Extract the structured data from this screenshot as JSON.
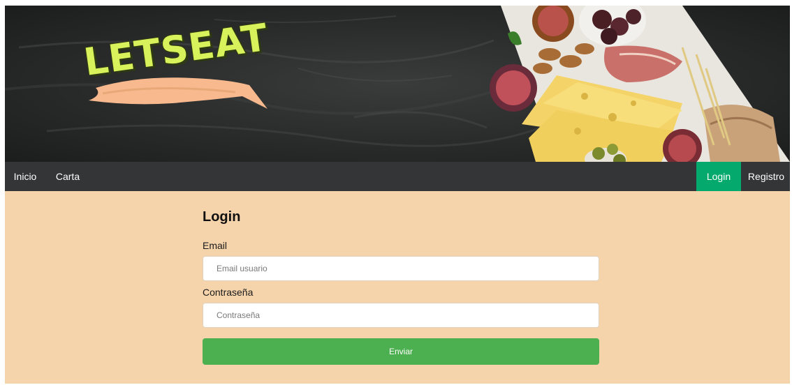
{
  "brand": {
    "logo_text": "LETSEAT"
  },
  "nav": {
    "left": [
      "Inicio",
      "Carta"
    ],
    "login": "Login",
    "registro": "Registro"
  },
  "form": {
    "title": "Login",
    "email_label": "Email",
    "email_placeholder": "Email usuario",
    "email_value": "",
    "password_label": "Contraseña",
    "password_placeholder": "Contraseña",
    "password_value": "",
    "submit_label": "Enviar"
  },
  "colors": {
    "navbar": "#333536",
    "active_nav": "#04aa6d",
    "page_background": "#f6d4ab",
    "submit_button": "#4caf50",
    "logo_text": "#d7f25a"
  }
}
